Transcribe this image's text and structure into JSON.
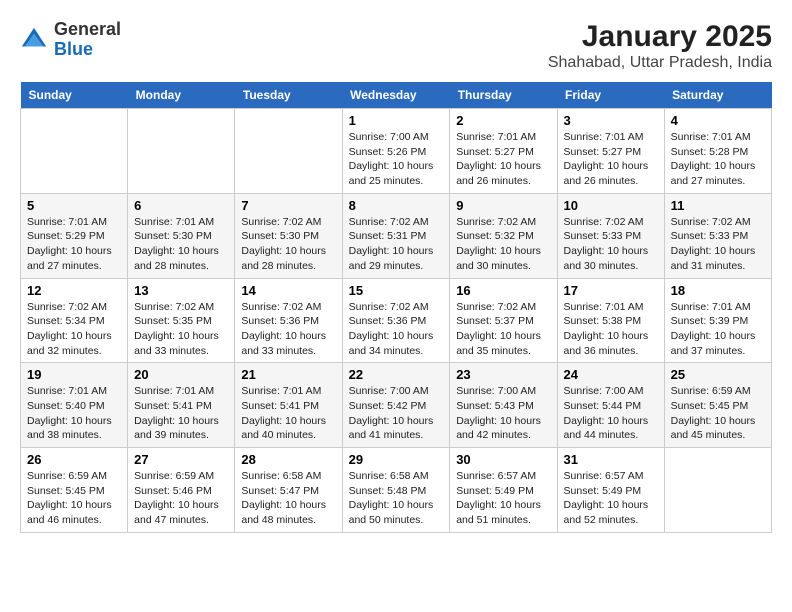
{
  "header": {
    "logo": {
      "general": "General",
      "blue": "Blue"
    },
    "title": "January 2025",
    "subtitle": "Shahabad, Uttar Pradesh, India"
  },
  "days_of_week": [
    "Sunday",
    "Monday",
    "Tuesday",
    "Wednesday",
    "Thursday",
    "Friday",
    "Saturday"
  ],
  "weeks": [
    [
      {
        "num": "",
        "sunrise": "",
        "sunset": "",
        "daylight": ""
      },
      {
        "num": "",
        "sunrise": "",
        "sunset": "",
        "daylight": ""
      },
      {
        "num": "",
        "sunrise": "",
        "sunset": "",
        "daylight": ""
      },
      {
        "num": "1",
        "sunrise": "Sunrise: 7:00 AM",
        "sunset": "Sunset: 5:26 PM",
        "daylight": "Daylight: 10 hours and 25 minutes."
      },
      {
        "num": "2",
        "sunrise": "Sunrise: 7:01 AM",
        "sunset": "Sunset: 5:27 PM",
        "daylight": "Daylight: 10 hours and 26 minutes."
      },
      {
        "num": "3",
        "sunrise": "Sunrise: 7:01 AM",
        "sunset": "Sunset: 5:27 PM",
        "daylight": "Daylight: 10 hours and 26 minutes."
      },
      {
        "num": "4",
        "sunrise": "Sunrise: 7:01 AM",
        "sunset": "Sunset: 5:28 PM",
        "daylight": "Daylight: 10 hours and 27 minutes."
      }
    ],
    [
      {
        "num": "5",
        "sunrise": "Sunrise: 7:01 AM",
        "sunset": "Sunset: 5:29 PM",
        "daylight": "Daylight: 10 hours and 27 minutes."
      },
      {
        "num": "6",
        "sunrise": "Sunrise: 7:01 AM",
        "sunset": "Sunset: 5:30 PM",
        "daylight": "Daylight: 10 hours and 28 minutes."
      },
      {
        "num": "7",
        "sunrise": "Sunrise: 7:02 AM",
        "sunset": "Sunset: 5:30 PM",
        "daylight": "Daylight: 10 hours and 28 minutes."
      },
      {
        "num": "8",
        "sunrise": "Sunrise: 7:02 AM",
        "sunset": "Sunset: 5:31 PM",
        "daylight": "Daylight: 10 hours and 29 minutes."
      },
      {
        "num": "9",
        "sunrise": "Sunrise: 7:02 AM",
        "sunset": "Sunset: 5:32 PM",
        "daylight": "Daylight: 10 hours and 30 minutes."
      },
      {
        "num": "10",
        "sunrise": "Sunrise: 7:02 AM",
        "sunset": "Sunset: 5:33 PM",
        "daylight": "Daylight: 10 hours and 30 minutes."
      },
      {
        "num": "11",
        "sunrise": "Sunrise: 7:02 AM",
        "sunset": "Sunset: 5:33 PM",
        "daylight": "Daylight: 10 hours and 31 minutes."
      }
    ],
    [
      {
        "num": "12",
        "sunrise": "Sunrise: 7:02 AM",
        "sunset": "Sunset: 5:34 PM",
        "daylight": "Daylight: 10 hours and 32 minutes."
      },
      {
        "num": "13",
        "sunrise": "Sunrise: 7:02 AM",
        "sunset": "Sunset: 5:35 PM",
        "daylight": "Daylight: 10 hours and 33 minutes."
      },
      {
        "num": "14",
        "sunrise": "Sunrise: 7:02 AM",
        "sunset": "Sunset: 5:36 PM",
        "daylight": "Daylight: 10 hours and 33 minutes."
      },
      {
        "num": "15",
        "sunrise": "Sunrise: 7:02 AM",
        "sunset": "Sunset: 5:36 PM",
        "daylight": "Daylight: 10 hours and 34 minutes."
      },
      {
        "num": "16",
        "sunrise": "Sunrise: 7:02 AM",
        "sunset": "Sunset: 5:37 PM",
        "daylight": "Daylight: 10 hours and 35 minutes."
      },
      {
        "num": "17",
        "sunrise": "Sunrise: 7:01 AM",
        "sunset": "Sunset: 5:38 PM",
        "daylight": "Daylight: 10 hours and 36 minutes."
      },
      {
        "num": "18",
        "sunrise": "Sunrise: 7:01 AM",
        "sunset": "Sunset: 5:39 PM",
        "daylight": "Daylight: 10 hours and 37 minutes."
      }
    ],
    [
      {
        "num": "19",
        "sunrise": "Sunrise: 7:01 AM",
        "sunset": "Sunset: 5:40 PM",
        "daylight": "Daylight: 10 hours and 38 minutes."
      },
      {
        "num": "20",
        "sunrise": "Sunrise: 7:01 AM",
        "sunset": "Sunset: 5:41 PM",
        "daylight": "Daylight: 10 hours and 39 minutes."
      },
      {
        "num": "21",
        "sunrise": "Sunrise: 7:01 AM",
        "sunset": "Sunset: 5:41 PM",
        "daylight": "Daylight: 10 hours and 40 minutes."
      },
      {
        "num": "22",
        "sunrise": "Sunrise: 7:00 AM",
        "sunset": "Sunset: 5:42 PM",
        "daylight": "Daylight: 10 hours and 41 minutes."
      },
      {
        "num": "23",
        "sunrise": "Sunrise: 7:00 AM",
        "sunset": "Sunset: 5:43 PM",
        "daylight": "Daylight: 10 hours and 42 minutes."
      },
      {
        "num": "24",
        "sunrise": "Sunrise: 7:00 AM",
        "sunset": "Sunset: 5:44 PM",
        "daylight": "Daylight: 10 hours and 44 minutes."
      },
      {
        "num": "25",
        "sunrise": "Sunrise: 6:59 AM",
        "sunset": "Sunset: 5:45 PM",
        "daylight": "Daylight: 10 hours and 45 minutes."
      }
    ],
    [
      {
        "num": "26",
        "sunrise": "Sunrise: 6:59 AM",
        "sunset": "Sunset: 5:45 PM",
        "daylight": "Daylight: 10 hours and 46 minutes."
      },
      {
        "num": "27",
        "sunrise": "Sunrise: 6:59 AM",
        "sunset": "Sunset: 5:46 PM",
        "daylight": "Daylight: 10 hours and 47 minutes."
      },
      {
        "num": "28",
        "sunrise": "Sunrise: 6:58 AM",
        "sunset": "Sunset: 5:47 PM",
        "daylight": "Daylight: 10 hours and 48 minutes."
      },
      {
        "num": "29",
        "sunrise": "Sunrise: 6:58 AM",
        "sunset": "Sunset: 5:48 PM",
        "daylight": "Daylight: 10 hours and 50 minutes."
      },
      {
        "num": "30",
        "sunrise": "Sunrise: 6:57 AM",
        "sunset": "Sunset: 5:49 PM",
        "daylight": "Daylight: 10 hours and 51 minutes."
      },
      {
        "num": "31",
        "sunrise": "Sunrise: 6:57 AM",
        "sunset": "Sunset: 5:49 PM",
        "daylight": "Daylight: 10 hours and 52 minutes."
      },
      {
        "num": "",
        "sunrise": "",
        "sunset": "",
        "daylight": ""
      }
    ]
  ]
}
